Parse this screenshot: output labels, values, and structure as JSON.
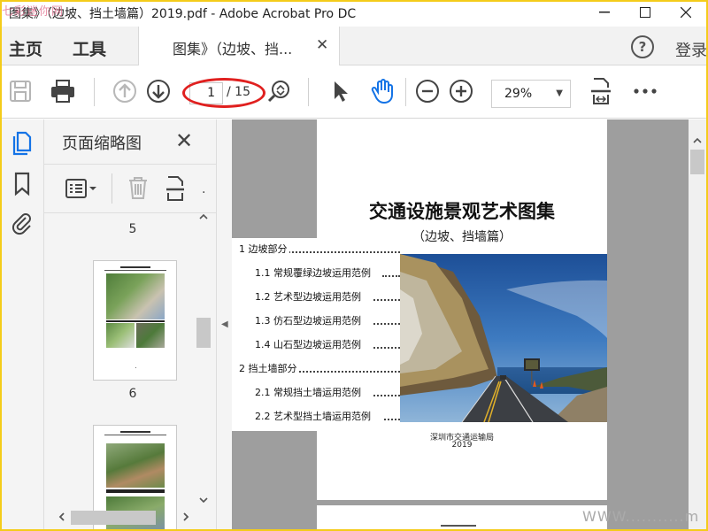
{
  "window": {
    "title": "图集》（边坡、挡土墙篇）2019.pdf - Adobe Acrobat Pro DC",
    "watermark_logo": "七彩迷你网"
  },
  "menubar": {
    "home": "主页",
    "tools": "工具",
    "doc_tab": "图集》（边坡、挡...",
    "login": "登录"
  },
  "toolbar": {
    "current_page": "1",
    "page_total": "/ 15",
    "zoom": "29%"
  },
  "thumbnails": {
    "title": "页面缩略图",
    "pages": [
      {
        "label": "5",
        "caption": "."
      },
      {
        "label": "6"
      }
    ]
  },
  "document": {
    "title": "交通设施景观艺术图集",
    "subtitle": "（边坡、挡墙篇）",
    "toc": [
      {
        "text": "1 边坡部分",
        "level": 1
      },
      {
        "text": "1.1 常规覆绿边坡运用范例",
        "level": 2
      },
      {
        "text": "1.2 艺术型边坡运用范例",
        "level": 2
      },
      {
        "text": "1.3 仿石型边坡运用范例",
        "level": 2
      },
      {
        "text": "1.4 山石型边坡运用范例",
        "level": 2
      },
      {
        "text": "2 挡土墙部分",
        "level": 1
      },
      {
        "text": "2.1 常规挡土墙运用范例",
        "level": 2
      },
      {
        "text": "2.2 艺术型挡土墙运用范例",
        "level": 2
      }
    ],
    "org": "深圳市交通运输局",
    "year": "2019"
  },
  "watermark_url": "WWW...........m"
}
